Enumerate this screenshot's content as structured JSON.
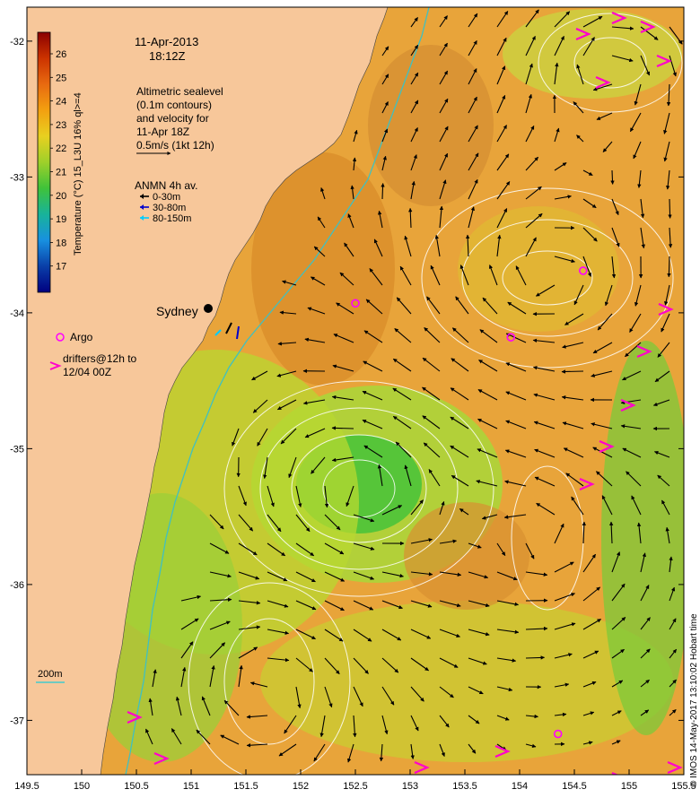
{
  "title": {
    "date": "11-Apr-2013",
    "time": "18:12Z"
  },
  "description_lines": [
    "Altimetric sealevel",
    "(0.1m contours)",
    "and velocity for",
    "11-Apr 18Z",
    "0.5m/s (1kt 12h)"
  ],
  "anmn": {
    "heading": "ANMN 4h av.",
    "items": [
      {
        "label": "0-30m",
        "color": "#000000"
      },
      {
        "label": "30-80m",
        "color": "#0000cc"
      },
      {
        "label": "80-150m",
        "color": "#00ccff"
      }
    ]
  },
  "colorbar": {
    "label": "Temperature (°C) 15_L3U 16% ql>=4",
    "ticks": [
      "26",
      "25",
      "24",
      "23",
      "22",
      "21",
      "20",
      "19",
      "18",
      "17"
    ],
    "colors": [
      "#8b0000",
      "#cc3300",
      "#e86a10",
      "#f3a010",
      "#e8d020",
      "#9ed02a",
      "#3fc23a",
      "#18b39a",
      "#1890e0",
      "#0a3fa8",
      "#000080"
    ]
  },
  "city": "Sydney",
  "legend": {
    "argo_label": "Argo",
    "drifters_line1": "drifters@12h to",
    "drifters_line2": "12/04 00Z",
    "argo_color": "#ff00ff",
    "drifter_color": "#ff00cc"
  },
  "scale": {
    "label": "200m",
    "color": "#44cccc"
  },
  "axes": {
    "x_ticks": [
      "149.5",
      "150",
      "150.5",
      "151",
      "151.5",
      "152",
      "152.5",
      "153",
      "153.5",
      "154",
      "154.5",
      "155",
      "155.5"
    ],
    "y_ticks": [
      "-32",
      "-33",
      "-34",
      "-35",
      "-36",
      "-37"
    ],
    "x_range": [
      149.5,
      155.5
    ],
    "y_range": [
      -37.4,
      -31.75
    ]
  },
  "credit": "© IMOS 14-May-2017 13:10:02 Hobart time",
  "colors": {
    "land": "#f7c79a",
    "ocean_warm": "#e8a020",
    "ocean_cool": "#8ccf3a",
    "contour": "#ffffff",
    "isobath": "#40c0c0"
  },
  "argo_floats": [
    {
      "lon": 152.5,
      "lat": -33.93
    },
    {
      "lon": 153.92,
      "lat": -34.18
    },
    {
      "lon": 154.58,
      "lat": -33.69
    },
    {
      "lon": 154.35,
      "lat": -37.1
    }
  ]
}
